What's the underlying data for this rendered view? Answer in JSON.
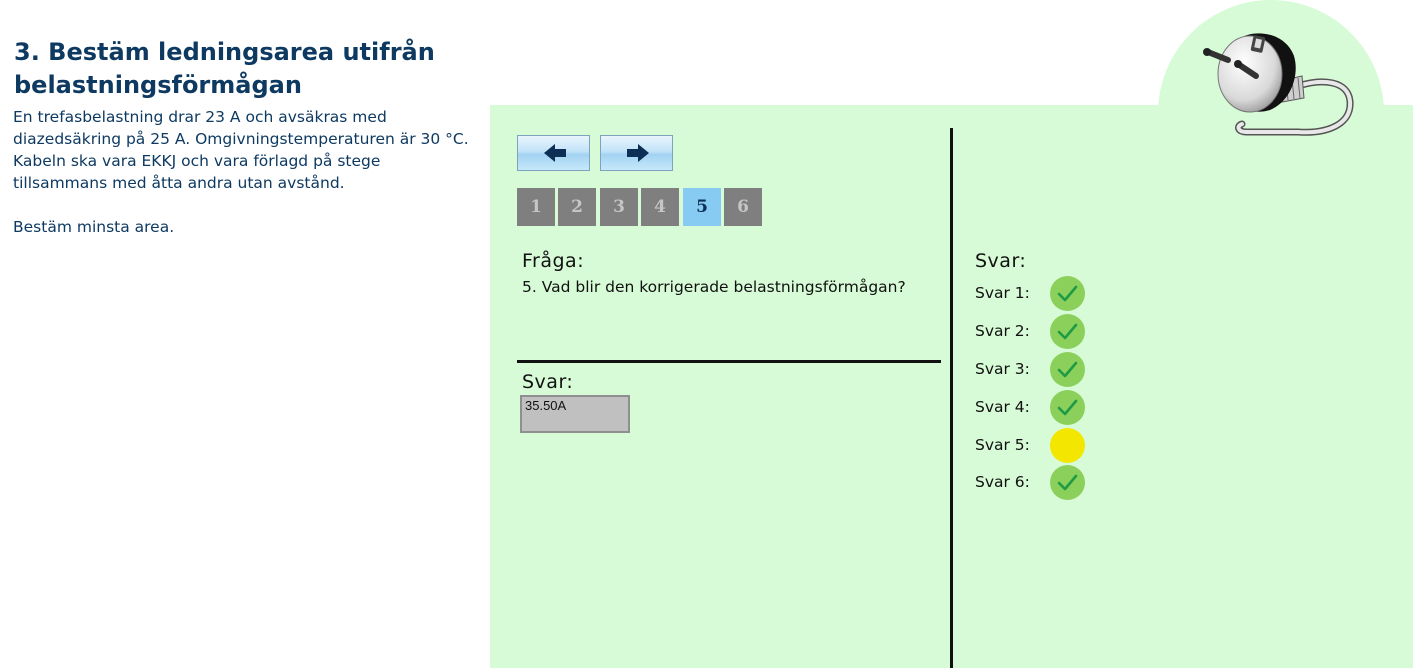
{
  "header": {
    "title": "3. Bestäm ledningsarea utifrån belastningsförmågan",
    "problem_text": "En trefasbelastning drar 23 A och avsäkras med diazedsäkring på 25 A. Omgivningstemperaturen är 30 °C. Kabeln ska vara EKKJ och vara förlagd på stege tillsammans med åtta andra utan avstånd.\n\nBestäm minsta area."
  },
  "nav": {
    "prev_icon": "arrow-left-icon",
    "next_icon": "arrow-right-icon",
    "pages": [
      "1",
      "2",
      "3",
      "4",
      "5",
      "6"
    ],
    "active_page": "5"
  },
  "question": {
    "heading": "Fråga:",
    "text": "5. Vad blir den korrigerade belastningsförmågan?"
  },
  "answer": {
    "heading": "Svar:",
    "value": "35.50A"
  },
  "status": {
    "heading": "Svar:",
    "rows": [
      {
        "label": "Svar 1:",
        "state": "correct",
        "icon": "checkmark-icon"
      },
      {
        "label": "Svar 2:",
        "state": "correct",
        "icon": "checkmark-icon"
      },
      {
        "label": "Svar 3:",
        "state": "correct",
        "icon": "checkmark-icon"
      },
      {
        "label": "Svar 4:",
        "state": "correct",
        "icon": "checkmark-icon"
      },
      {
        "label": "Svar 5:",
        "state": "pending",
        "icon": "pending-dot-icon"
      },
      {
        "label": "Svar 6:",
        "state": "correct",
        "icon": "checkmark-icon"
      }
    ]
  },
  "colors": {
    "panel_bg": "#d7fbd6",
    "title_color": "#0e3a62",
    "active_page_bg": "#87cbf2",
    "inactive_page_bg": "#7f7f7f",
    "correct_bg": "#8ad05a",
    "check_color": "#1f9a45",
    "pending_bg": "#f3e600"
  }
}
